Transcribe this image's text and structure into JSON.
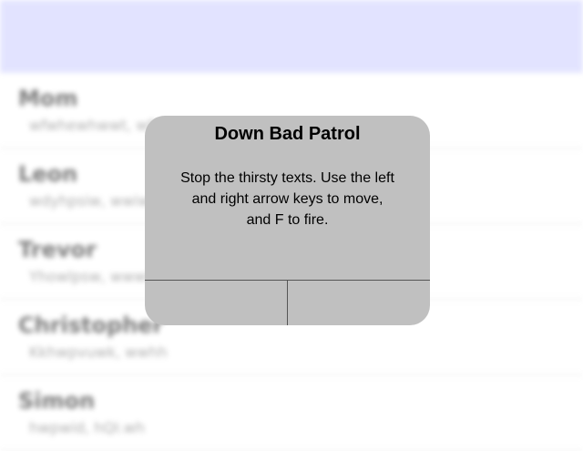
{
  "backdrop": {
    "contacts": [
      {
        "name": "Mom",
        "preview": "wfwhewhwwt, wfwhe"
      },
      {
        "name": "Leon",
        "preview": "wdyhpsiw, wwiww"
      },
      {
        "name": "Trevor",
        "preview": "Yhowlpsw, wwwhewhwwwwhwwwhwwwhwww"
      },
      {
        "name": "Christopher",
        "preview": "Kkhwpvuwk, wwhh"
      },
      {
        "name": "Simon",
        "preview": "hwpwid, hQI.wh"
      }
    ]
  },
  "dialog": {
    "title": "Down Bad Patrol",
    "message": "Stop the thirsty texts. Use the left and right arrow keys to move, and F to fire.",
    "buttons": [
      {
        "label": ""
      },
      {
        "label": ""
      }
    ]
  },
  "colors": {
    "header_bar": "#d0d2ff",
    "dialog_background": "#c0c0c0",
    "divider": "#555555"
  }
}
